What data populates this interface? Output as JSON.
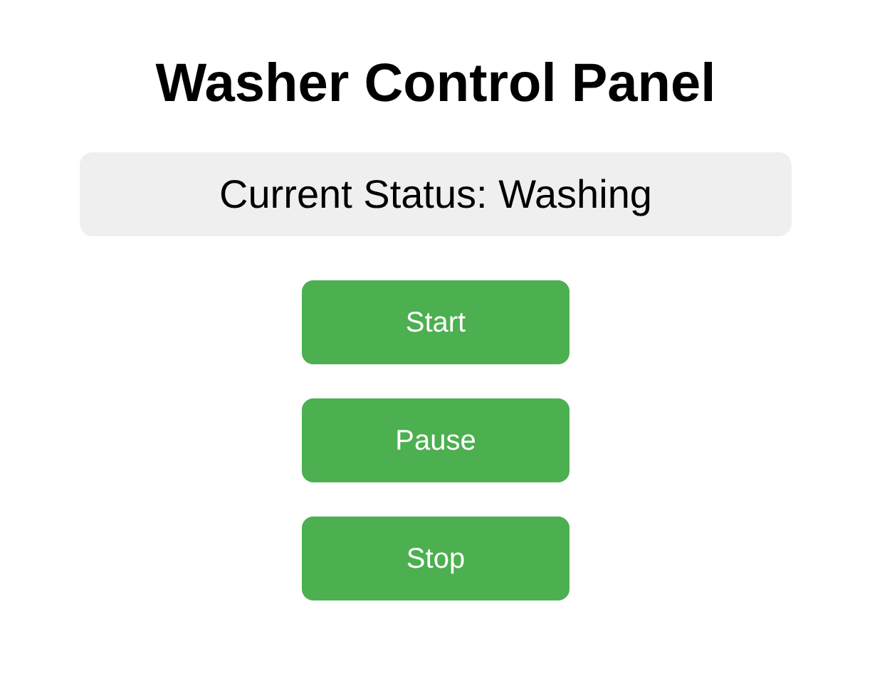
{
  "title": "Washer Control Panel",
  "status": "Current Status: Washing",
  "buttons": [
    "Start",
    "Pause",
    "Stop"
  ]
}
